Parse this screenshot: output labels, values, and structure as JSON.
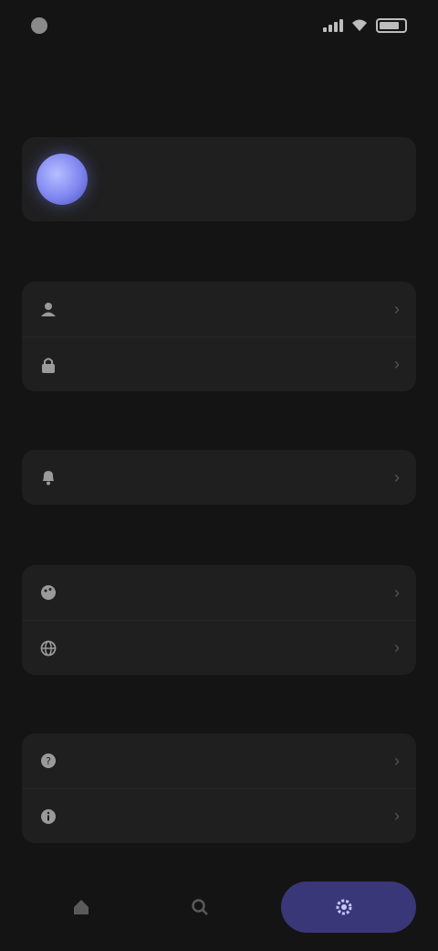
{
  "status_bar": {
    "time": "",
    "icons": [
      "signal-icon",
      "wifi-icon",
      "battery-icon"
    ],
    "battery_level": 0.8
  },
  "page": {
    "title": ""
  },
  "profile": {
    "name": "",
    "subtitle": "",
    "avatar_color": "#7f86f0"
  },
  "sections": [
    {
      "header": "",
      "items": [
        {
          "label": "",
          "icon": "person-icon"
        },
        {
          "label": "",
          "icon": "lock-icon"
        }
      ]
    },
    {
      "header": "",
      "items": [
        {
          "label": "",
          "icon": "bell-icon"
        }
      ]
    },
    {
      "header": "",
      "items": [
        {
          "label": "",
          "icon": "palette-icon"
        },
        {
          "label": "",
          "icon": "globe-icon"
        }
      ]
    },
    {
      "header": "",
      "items": [
        {
          "label": "",
          "icon": "help-icon"
        },
        {
          "label": "",
          "icon": "info-icon"
        }
      ]
    }
  ],
  "bottom_nav": {
    "items": [
      {
        "icon": "home-icon",
        "label": ""
      },
      {
        "icon": "search-icon",
        "label": ""
      },
      {
        "icon": "settings-icon",
        "label": "",
        "active": true
      }
    ],
    "active_color": "#3a3778"
  }
}
